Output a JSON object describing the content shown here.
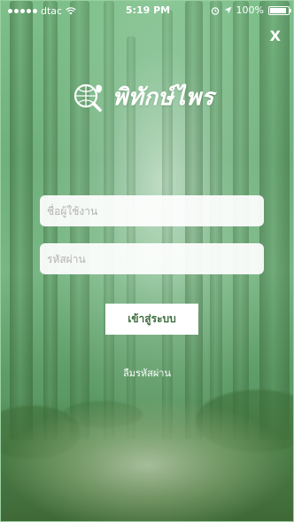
{
  "status_bar": {
    "carrier": "dtac",
    "time": "5:19 PM",
    "battery": "100%"
  },
  "close_label": "X",
  "brand": {
    "name": "พิทักษ์ไพร"
  },
  "login": {
    "username_placeholder": "ชื่อผู้ใช้งาน",
    "password_placeholder": "รหัสผ่าน",
    "submit_label": "เข้าสู่ระบบ",
    "forgot_label": "ลืมรหัสผ่าน"
  },
  "colors": {
    "background": "#7ab886",
    "button_text": "#3f6f3f",
    "text_on_bg": "#ffffff"
  },
  "icons": {
    "logo": "globe-magnifier-leaf-icon",
    "wifi": "wifi-icon",
    "location": "location-arrow-icon",
    "alarm": "alarm-icon",
    "battery": "battery-icon"
  }
}
